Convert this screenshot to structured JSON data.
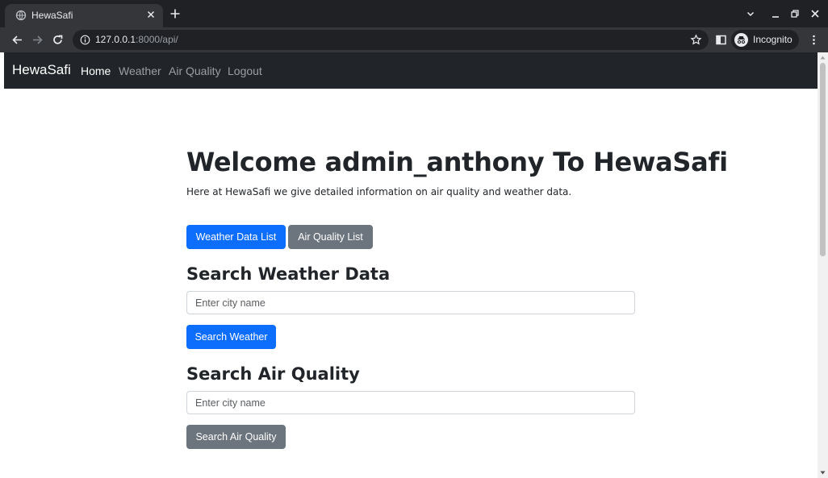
{
  "browser": {
    "tab_title": "HewaSafi",
    "url_host": "127.0.0.1",
    "url_rest": ":8000/api/",
    "profile_label": "Incognito"
  },
  "navbar": {
    "brand": "HewaSafi",
    "links": [
      {
        "label": "Home",
        "active": true
      },
      {
        "label": "Weather"
      },
      {
        "label": "Air Quality"
      },
      {
        "label": "Logout"
      }
    ]
  },
  "main": {
    "heading": "Welcome admin_anthony To HewaSafi",
    "intro": "Here at HewaSafi we give detailed information on air quality and weather data.",
    "weather_list_button": "Weather Data List",
    "air_quality_list_button": "Air Quality List",
    "weather_search": {
      "heading": "Search Weather Data",
      "placeholder": "Enter city name",
      "button": "Search Weather"
    },
    "air_search": {
      "heading": "Search Air Quality",
      "placeholder": "Enter city name",
      "button": "Search Air Quality"
    }
  },
  "colors": {
    "primary": "#0d6efd",
    "secondary": "#6c757d",
    "navbar": "#212529"
  }
}
